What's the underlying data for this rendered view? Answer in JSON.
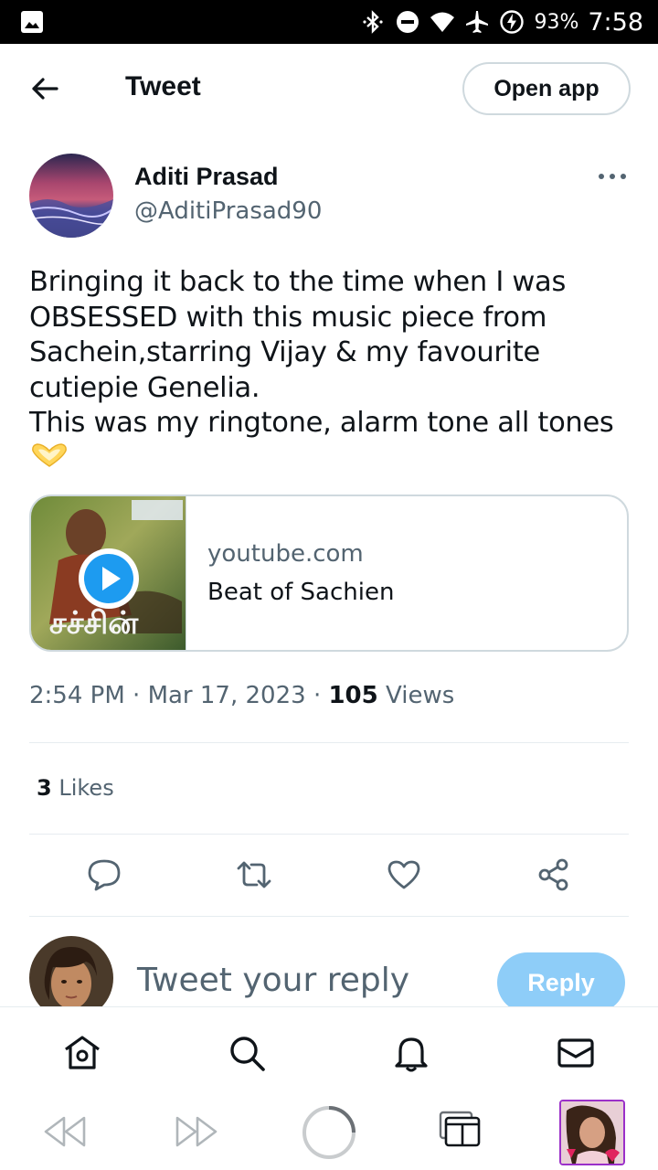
{
  "status_bar": {
    "battery_percent": "93%",
    "time": "7:58"
  },
  "header": {
    "title": "Tweet",
    "open_app_label": "Open app"
  },
  "author": {
    "name": "Aditi Prasad",
    "handle": "@AditiPrasad90"
  },
  "tweet": {
    "text": "Bringing it back to the time when I was\nOBSESSED with this music piece from\nSachein,starring Vijay & my favourite\ncutiepie Genelia.\nThis was my ringtone, alarm tone all tones",
    "emoji": "heart-hands-emoji"
  },
  "card": {
    "domain": "youtube.com",
    "title": "Beat of Sachien"
  },
  "meta": {
    "time": "2:54 PM",
    "date": "Mar 17, 2023",
    "views_count": "105",
    "views_label": "Views"
  },
  "likes": {
    "count": "3",
    "label": "Likes"
  },
  "reply": {
    "placeholder": "Tweet your reply",
    "button_label": "Reply"
  },
  "colors": {
    "accent": "#1d9bf0",
    "reply_button": "#8ecdf8",
    "secondary_text": "#536471",
    "border": "#cfd9de"
  }
}
